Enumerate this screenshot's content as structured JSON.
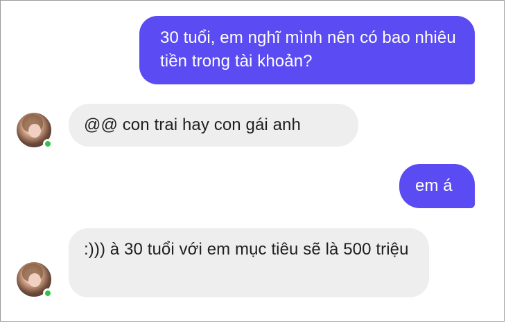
{
  "conversation": {
    "messages": [
      {
        "sender": "me",
        "text": "30 tuổi, em nghĩ mình nên có bao nhiêu tiền trong tài khoản?"
      },
      {
        "sender": "contact",
        "text": "@@ con trai hay con gái anh"
      },
      {
        "sender": "me",
        "text": "em á"
      },
      {
        "sender": "contact",
        "text": ":))) à 30 tuổi với em mục tiêu sẽ là 500 triệu"
      }
    ]
  },
  "colors": {
    "outgoing_bubble": "#5b4bf2",
    "incoming_bubble": "#eeeeef",
    "online_dot": "#31c24a"
  },
  "icons": {
    "avatar": "contact-avatar",
    "status": "online-status-dot"
  }
}
